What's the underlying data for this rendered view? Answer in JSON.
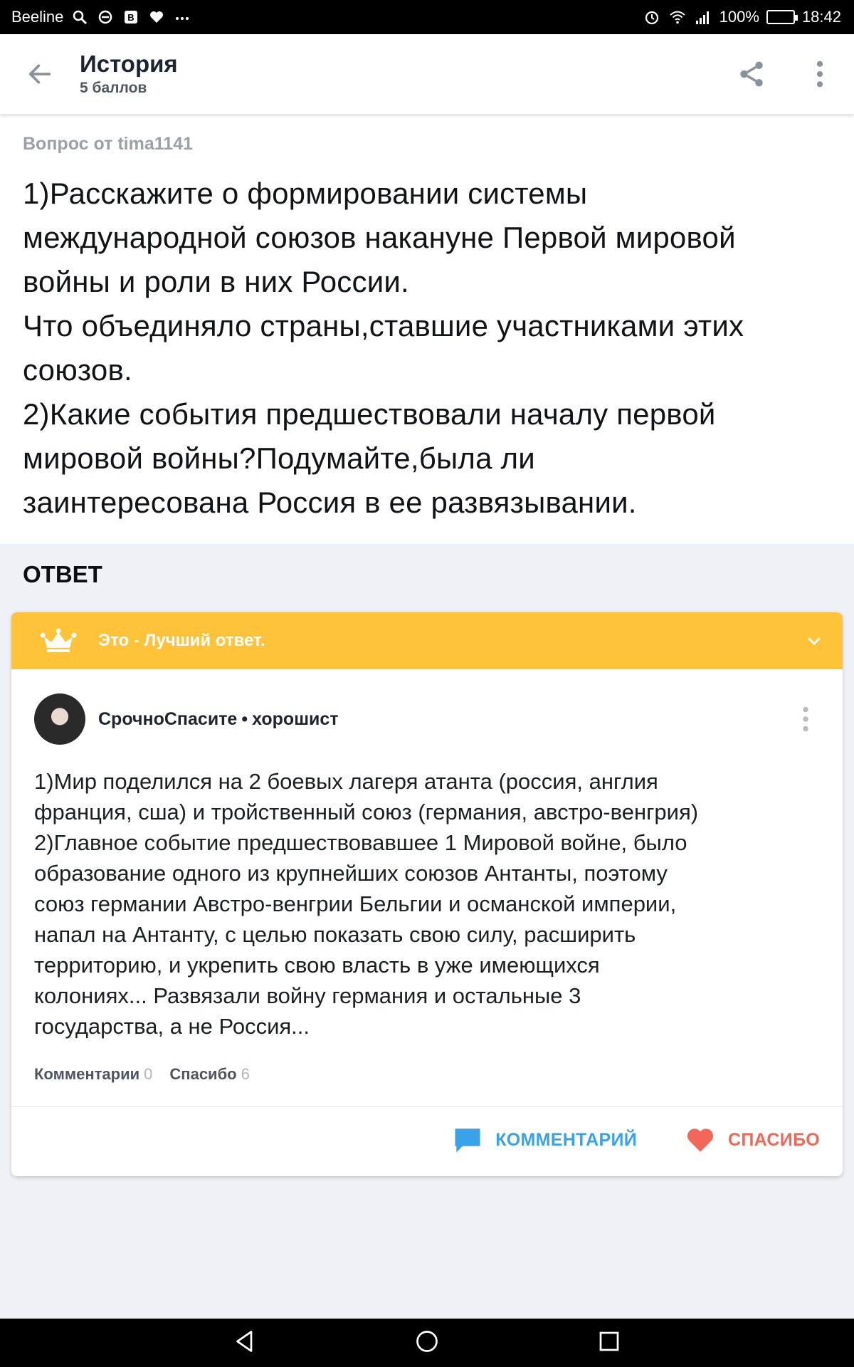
{
  "status_bar": {
    "carrier": "Beeline",
    "battery": "100%",
    "time": "18:42",
    "icons": [
      "search-icon",
      "sync-icon",
      "b-icon",
      "heart-icon",
      "more-icon",
      "alarm-icon",
      "wifi-icon",
      "signal-icon",
      "battery-icon"
    ]
  },
  "header": {
    "title": "История",
    "subtitle": "5 баллов"
  },
  "question": {
    "meta": "Вопрос от tima1141",
    "text": "1)Расскажите о формировании системы\nмеждународной союзов накануне Первой мировой\nвойны и роли в них России.\nЧто объединяло страны,ставшие участниками этих\nсоюзов.\n2)Какие события предшествовали началу первой\nмировой войны?Подумайте,была ли\nзаинтересована Россия в ее развязывании."
  },
  "answer": {
    "heading": "ОТВЕТ",
    "best_label": "Это - Лучший ответ.",
    "author": "СрочноСпасите",
    "author_separator": "•",
    "author_rank": "хорошист",
    "text": "1)Мир поделился на 2 боевых лагеря атанта (россия, англия\nфранция, сша) и тройственный союз (германия, австро-венгрия)\n2)Главное событие предшествовавшее 1 Мировой войне, было\nобразование одного из крупнейших союзов Антанты, поэтому\nсоюз германии Австро-венгрии Бельгии и османской империи,\nнапал на Антанту, с целью показать свою силу, расширить\nтерриторию, и укрепить свою власть в уже имеющихся\nколониях... Развязали войну германия и остальные 3\nгосударства, а не Россия...",
    "comments_label": "Комментарии",
    "comments_count": "0",
    "thanks_label": "Спасибо",
    "thanks_count": "6",
    "comment_button": "КОММЕНТАРИЙ",
    "thanks_button": "СПАСИБО"
  },
  "colors": {
    "banner": "#ffc33a",
    "comment_accent": "#3aa2e8",
    "thanks_accent": "#f26757"
  }
}
